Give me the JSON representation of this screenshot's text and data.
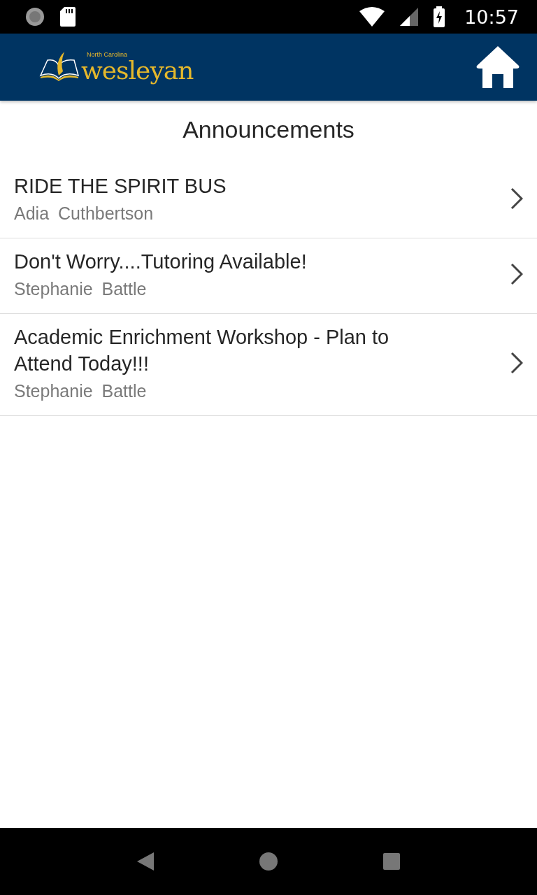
{
  "status_bar": {
    "time": "10:57"
  },
  "header": {
    "logo": {
      "small_text": "North Carolina",
      "name": "wesleyan"
    }
  },
  "page_title": "Announcements",
  "announcements": [
    {
      "title": "RIDE THE SPIRIT BUS",
      "author": "Adia Cuthbertson"
    },
    {
      "title": "Don't Worry....Tutoring Available!",
      "author": "Stephanie Battle"
    },
    {
      "title": "Academic Enrichment Workshop - Plan to Attend Today!!!",
      "author": "Stephanie Battle"
    }
  ]
}
